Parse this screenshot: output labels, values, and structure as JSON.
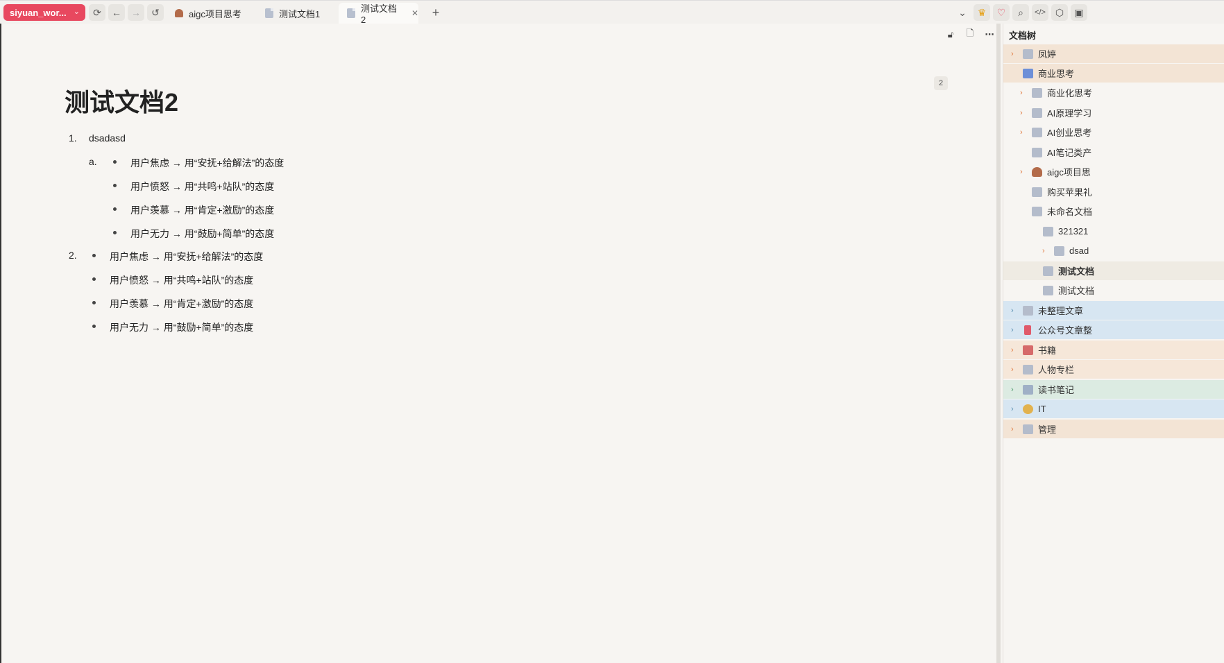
{
  "workspace": {
    "label": "siyuan_wor...",
    "color": "#e8485f"
  },
  "tabs": [
    {
      "label": "aigc项目思考",
      "icon": "poop-icon"
    },
    {
      "label": "测试文档1",
      "icon": "document-icon"
    },
    {
      "label": "测试文档2",
      "icon": "document-icon",
      "active": true
    }
  ],
  "toolbar": {
    "new_tab": "+",
    "dropdown": "⌄"
  },
  "editor": {
    "title": "测试文档2",
    "badge": "2",
    "list": {
      "item1": {
        "marker": "1.",
        "text": "dsadasd",
        "sub_marker": "a.",
        "bullets": [
          "用户焦虑 → 用“安抚+给解法”的态度",
          "用户愤怒 → 用“共鸣+站队”的态度",
          "用户羡慕 → 用“肯定+激励”的态度",
          "用户无力 → 用“鼓励+简单”的态度"
        ]
      },
      "item2": {
        "marker": "2.",
        "bullets": [
          "用户焦虑 → 用“安抚+给解法”的态度",
          "用户愤怒 → 用“共鸣+站队”的态度",
          "用户羡慕 → 用“肯定+激励”的态度",
          "用户无力 → 用“鼓励+简单”的态度"
        ]
      }
    }
  },
  "tree": {
    "title": "文档树",
    "items": [
      {
        "label": "凤婷"
      },
      {
        "label": "商业思考"
      },
      {
        "label": "商业化思考"
      },
      {
        "label": "AI原理学习"
      },
      {
        "label": "AI创业思考"
      },
      {
        "label": "AI笔记类产"
      },
      {
        "label": "aigc项目思"
      },
      {
        "label": "购买苹果礼"
      },
      {
        "label": "未命名文档"
      },
      {
        "label": "321321"
      },
      {
        "label": "dsad"
      },
      {
        "label": "测试文档"
      },
      {
        "label": "测试文档"
      },
      {
        "label": "未整理文章"
      },
      {
        "label": "公众号文章整"
      },
      {
        "label": "书籍"
      },
      {
        "label": "人物专栏"
      },
      {
        "label": "读书笔记"
      },
      {
        "label": "IT"
      },
      {
        "label": "管理"
      }
    ]
  }
}
